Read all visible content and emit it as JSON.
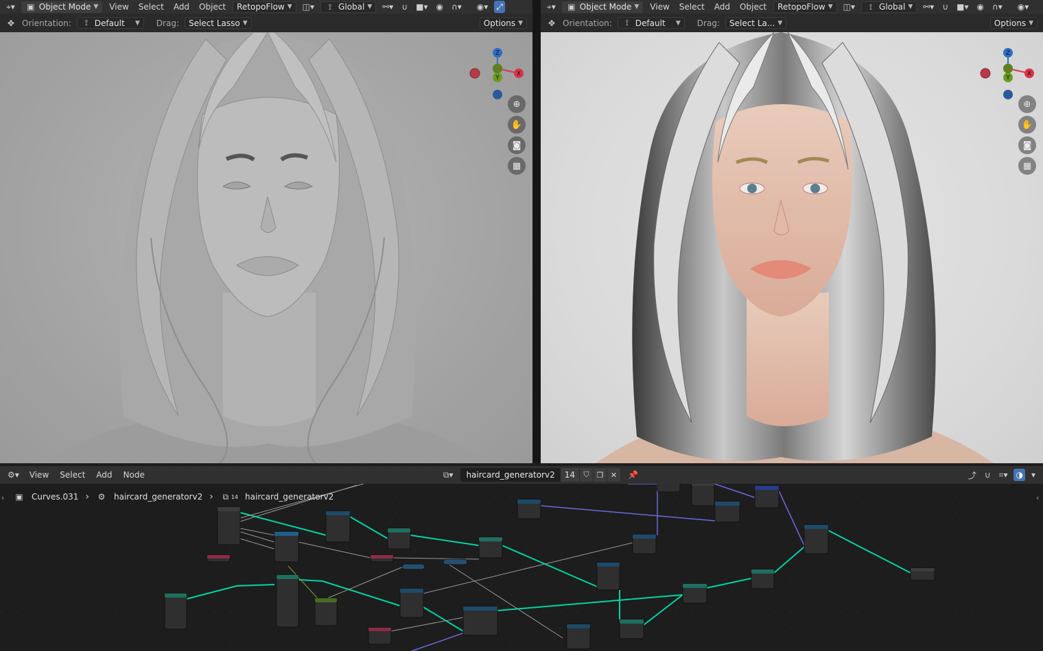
{
  "viewport_left": {
    "header": {
      "editor_icon": "editor-type-icon",
      "mode": "Object Mode",
      "menus": [
        "View",
        "Select",
        "Add",
        "Object"
      ],
      "addon": "RetopoFlow",
      "transform": "Global"
    },
    "toolbar": {
      "orientation_label": "Orientation:",
      "orientation_value": "Default",
      "drag_label": "Drag:",
      "drag_value": "Select Lasso",
      "options": "Options"
    },
    "gizmo": {
      "z": "Z",
      "y": "Y",
      "x": "X"
    },
    "shading": "solid"
  },
  "viewport_right": {
    "header": {
      "editor_icon": "editor-type-icon",
      "mode": "Object Mode",
      "menus": [
        "View",
        "Select",
        "Add",
        "Object"
      ],
      "addon": "RetopoFlow",
      "transform": "Global"
    },
    "toolbar": {
      "orientation_label": "Orientation:",
      "orientation_value": "Default",
      "drag_label": "Drag:",
      "drag_value": "Select La...",
      "options": "Options"
    },
    "gizmo": {
      "z": "Z",
      "y": "Y",
      "x": "X"
    },
    "shading": "rendered"
  },
  "node_editor": {
    "menus": [
      "View",
      "Select",
      "Add",
      "Node"
    ],
    "node_group": "haircard_generatorv2",
    "users": "14",
    "breadcrumb": {
      "object": "Curves.031",
      "modifier": "haircard_generatorv2",
      "node_tree": "haircard_generatorv2",
      "node_tree_users": "14"
    }
  },
  "colors": {
    "accent_blue": "#4772b3",
    "axis_x": "#d9344b",
    "axis_y": "#6a9b22",
    "axis_z": "#2f6fc4",
    "geometry_link": "#00d6a3",
    "node_header_geo": "#1f6f5f",
    "node_header_input": "#8f2a45"
  }
}
